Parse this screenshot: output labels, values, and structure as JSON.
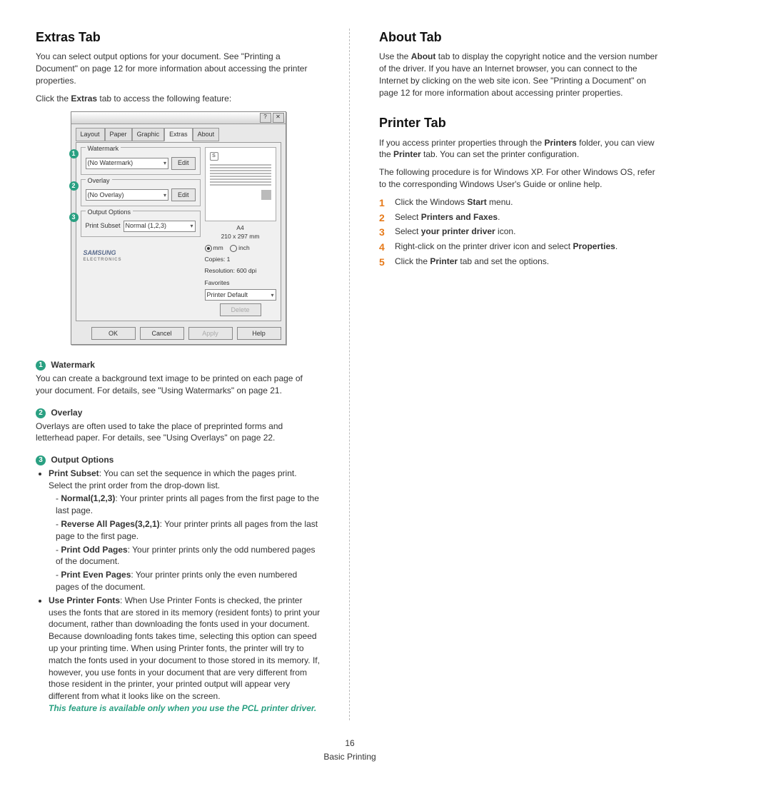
{
  "left": {
    "h1": "Extras Tab",
    "intro1": "You can select output options for your document. See \"Printing a Document\" on page 12 for more information about accessing the printer properties.",
    "intro2_a": "Click the ",
    "intro2_b": "Extras",
    "intro2_c": " tab to access the following feature:",
    "callouts": {
      "c1": {
        "num": "1",
        "title": "Watermark",
        "body": "You can create a background text image to be printed on each page of your document. For details, see \"Using Watermarks\" on page 21."
      },
      "c2": {
        "num": "2",
        "title": "Overlay",
        "body": "Overlays are often used to take the place of preprinted forms and letterhead paper. For details, see \"Using Overlays\" on page 22."
      },
      "c3": {
        "num": "3",
        "title": "Output Options",
        "bullet1_label": "Print Subset",
        "bullet1_body": ": You can set the sequence in which the pages print. Select the print order from the drop-down list.",
        "d1_label": "Normal(1,2,3)",
        "d1_body": ": Your printer prints all pages from the first page to the last page.",
        "d2_label": "Reverse All Pages(3,2,1)",
        "d2_body": ": Your printer prints all pages from the last page to the first page.",
        "d3_label": "Print Odd Pages",
        "d3_body": ": Your printer prints only the odd numbered pages of the document.",
        "d4_label": "Print Even Pages",
        "d4_body": ": Your printer prints only the even numbered pages of the document.",
        "bullet2_label": "Use Printer Fonts",
        "bullet2_body": ": When Use Printer Fonts is checked, the printer uses the fonts that are stored in its memory (resident fonts) to print your document, rather than downloading the fonts used in your document. Because downloading fonts takes time, selecting this option can speed up your printing time. When using Printer fonts, the printer will try to match the fonts used in your document to those stored in its memory. If, however, you use fonts in your document that are very different from those resident in the printer, your printed output will appear very different from what it looks like on the screen.",
        "note": "This feature is available only when you use the PCL printer driver."
      }
    },
    "dialog": {
      "tabs": [
        "Layout",
        "Paper",
        "Graphic",
        "Extras",
        "About"
      ],
      "watermark_legend": "Watermark",
      "watermark_value": "(No Watermark)",
      "edit": "Edit",
      "overlay_legend": "Overlay",
      "overlay_value": "(No Overlay)",
      "output_legend": "Output Options",
      "print_subset_label": "Print Subset",
      "print_subset_value": "Normal (1,2,3)",
      "preview_size_label": "A4",
      "preview_size_value": "210 x 297 mm",
      "unit_mm": "mm",
      "unit_inch": "inch",
      "copies": "Copies: 1",
      "resolution": "Resolution: 600 dpi",
      "favorites": "Favorites",
      "favorites_value": "Printer Default",
      "delete": "Delete",
      "brand": "SAMSUNG",
      "brand_sub": "ELECTRONICS",
      "ok": "OK",
      "cancel": "Cancel",
      "apply": "Apply",
      "help": "Help",
      "help_icon": "?",
      "close_icon": "✕"
    }
  },
  "right": {
    "about_h": "About Tab",
    "about_body_a": "Use the ",
    "about_body_b": "About",
    "about_body_c": " tab to display the copyright notice and the version number of the driver. If you have an Internet browser, you can connect to the Internet by clicking on the web site icon. See \"Printing a Document\" on page 12 for more information about accessing printer properties.",
    "printer_h": "Printer Tab",
    "printer_p1_a": "If you access printer properties through the ",
    "printer_p1_b": "Printers",
    "printer_p1_c": " folder, you can view the ",
    "printer_p1_d": "Printer",
    "printer_p1_e": " tab. You can set the printer configuration.",
    "printer_p2": "The following procedure is for Windows XP. For other Windows OS, refer to the corresponding Windows User's Guide or online help.",
    "steps": {
      "s1a": "Click the Windows ",
      "s1b": "Start",
      "s1c": " menu.",
      "s2a": "Select ",
      "s2b": "Printers and Faxes",
      "s2c": ".",
      "s3a": "Select ",
      "s3b": "your printer driver",
      "s3c": " icon.",
      "s4a": "Right-click on the printer driver icon and select ",
      "s4b": "Properties",
      "s4c": ".",
      "s5a": "Click the ",
      "s5b": "Printer",
      "s5c": " tab and set the options."
    }
  },
  "footer": {
    "page": "16",
    "section": "Basic Printing"
  }
}
